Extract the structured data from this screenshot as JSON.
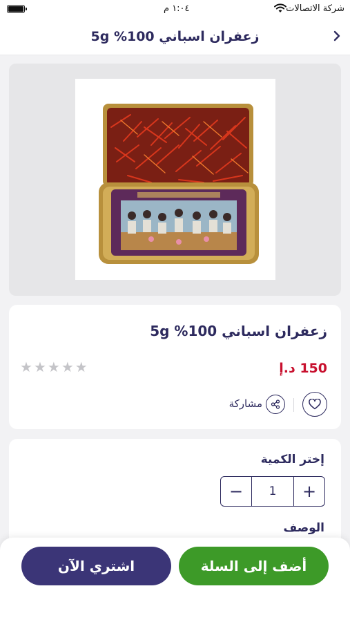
{
  "status_bar": {
    "carrier": "شركة الاتصالات",
    "time": "١:٠٤ م"
  },
  "header": {
    "title": "زعفران اسباني 100%  5g"
  },
  "product": {
    "name": "زعفران اسباني 100%  5g",
    "price": "150 د.إ",
    "rating": 0,
    "rating_max": 5,
    "share_label": "مشاركة",
    "image_icon": "saffron-tin-image"
  },
  "quantity": {
    "label": "إختر الكمية",
    "value": "1",
    "minus": "−",
    "plus": "+"
  },
  "description": {
    "label": "الوصف"
  },
  "actions": {
    "add_to_cart": "أضف إلى السلة",
    "buy_now": "اشتري الآن"
  },
  "colors": {
    "primary": "#2d2a5e",
    "buy_now": "#3b3577",
    "add_to_cart": "#3d9a28",
    "price": "#c8102e"
  }
}
